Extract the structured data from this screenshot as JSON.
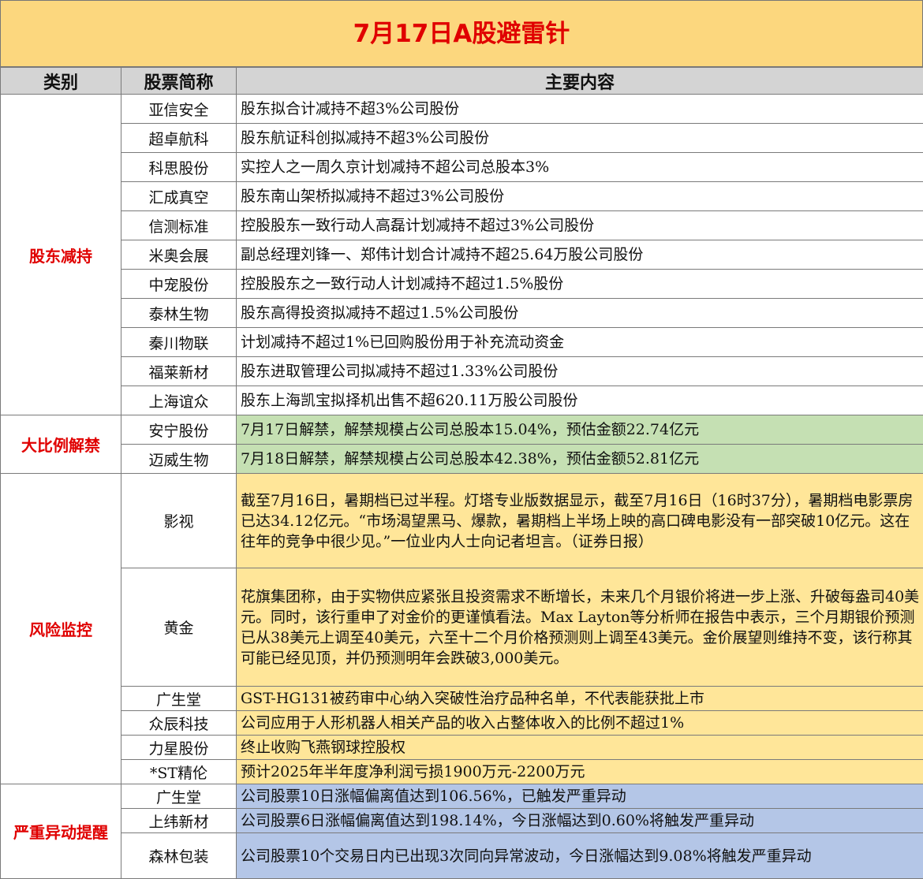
{
  "title": "7月17日A股避雷针",
  "headers": {
    "category": "类别",
    "stock": "股票简称",
    "content": "主要内容"
  },
  "sections": [
    {
      "category": "股东减持",
      "rows": [
        {
          "stock": "亚信安全",
          "content": "股东拟合计减持不超3%公司股份"
        },
        {
          "stock": "超卓航科",
          "content": "股东航证科创拟减持不超3%公司股份"
        },
        {
          "stock": "科思股份",
          "content": "实控人之一周久京计划减持不超公司总股本3%"
        },
        {
          "stock": "汇成真空",
          "content": "股东南山架桥拟减持不超过3%公司股份"
        },
        {
          "stock": "信测标准",
          "content": "控股股东一致行动人高磊计划减持不超过3%公司股份"
        },
        {
          "stock": "米奥会展",
          "content": "副总经理刘锋一、郑伟计划合计减持不超25.64万股公司股份"
        },
        {
          "stock": "中宠股份",
          "content": "控股股东之一致行动人计划减持不超过1.5%股份"
        },
        {
          "stock": "泰林生物",
          "content": "股东高得投资拟减持不超过1.5%公司股份"
        },
        {
          "stock": "秦川物联",
          "content": "计划减持不超过1%已回购股份用于补充流动资金"
        },
        {
          "stock": "福莱新材",
          "content": "股东进取管理公司拟减持不超过1.33%公司股份"
        },
        {
          "stock": "上海谊众",
          "content": "股东上海凯宝拟择机出售不超620.11万股公司股份"
        }
      ]
    },
    {
      "category": "大比例解禁",
      "rows": [
        {
          "stock": "安宁股份",
          "content": "7月17日解禁，解禁规模占公司总股本15.04%，预估金额22.74亿元"
        },
        {
          "stock": "迈威生物",
          "content": "7月18日解禁，解禁规模占公司总股本42.38%，预估金额52.81亿元"
        }
      ]
    },
    {
      "category": "风险监控",
      "rows": [
        {
          "stock": "影视",
          "content": "截至7月16日，暑期档已过半程。灯塔专业版数据显示，截至7月16日（16时37分），暑期档电影票房已达34.12亿元。“市场渴望黑马、爆款，暑期档上半场上映的高口碑电影没有一部突破10亿元。这在往年的竞争中很少见。”一位业内人士向记者坦言。（证券日报）"
        },
        {
          "stock": "黄金",
          "content": "花旗集团称，由于实物供应紧张且投资需求不断增长，未来几个月银价将进一步上涨、升破每盎司40美元。同时，该行重申了对金价的更谨慎看法。Max Layton等分析师在报告中表示，三个月期银价预测已从38美元上调至40美元，六至十二个月价格预测则上调至43美元。金价展望则维持不变，该行称其可能已经见顶，并仍预测明年会跌破3,000美元。"
        },
        {
          "stock": "广生堂",
          "content": "GST-HG131被药审中心纳入突破性治疗品种名单，不代表能获批上市"
        },
        {
          "stock": "众辰科技",
          "content": "公司应用于人形机器人相关产品的收入占整体收入的比例不超过1%"
        },
        {
          "stock": "力星股份",
          "content": "终止收购飞燕钢球控股权"
        },
        {
          "stock": "*ST精伦",
          "content": "预计2025年半年度净利润亏损1900万元-2200万元"
        }
      ]
    },
    {
      "category": "严重异动提醒",
      "rows": [
        {
          "stock": "广生堂",
          "content": "公司股票10日涨幅偏离值达到106.56%，已触发严重异动"
        },
        {
          "stock": "上纬新材",
          "content": "公司股票6日涨幅偏离值达到198.14%，今日涨幅达到0.60%将触发严重异动"
        },
        {
          "stock": "森林包装",
          "content": "公司股票10个交易日内已出现3次同向异常波动，今日涨幅达到9.08%将触发严重异动"
        }
      ]
    }
  ],
  "colors": {
    "title_bg": "#fcd77e",
    "title_text": "#e00000",
    "header_bg": "#d4d4d4",
    "unlock_bg": "#c5e0b3",
    "risk_bg": "#ffe699",
    "alert_bg": "#b4c6e7"
  }
}
